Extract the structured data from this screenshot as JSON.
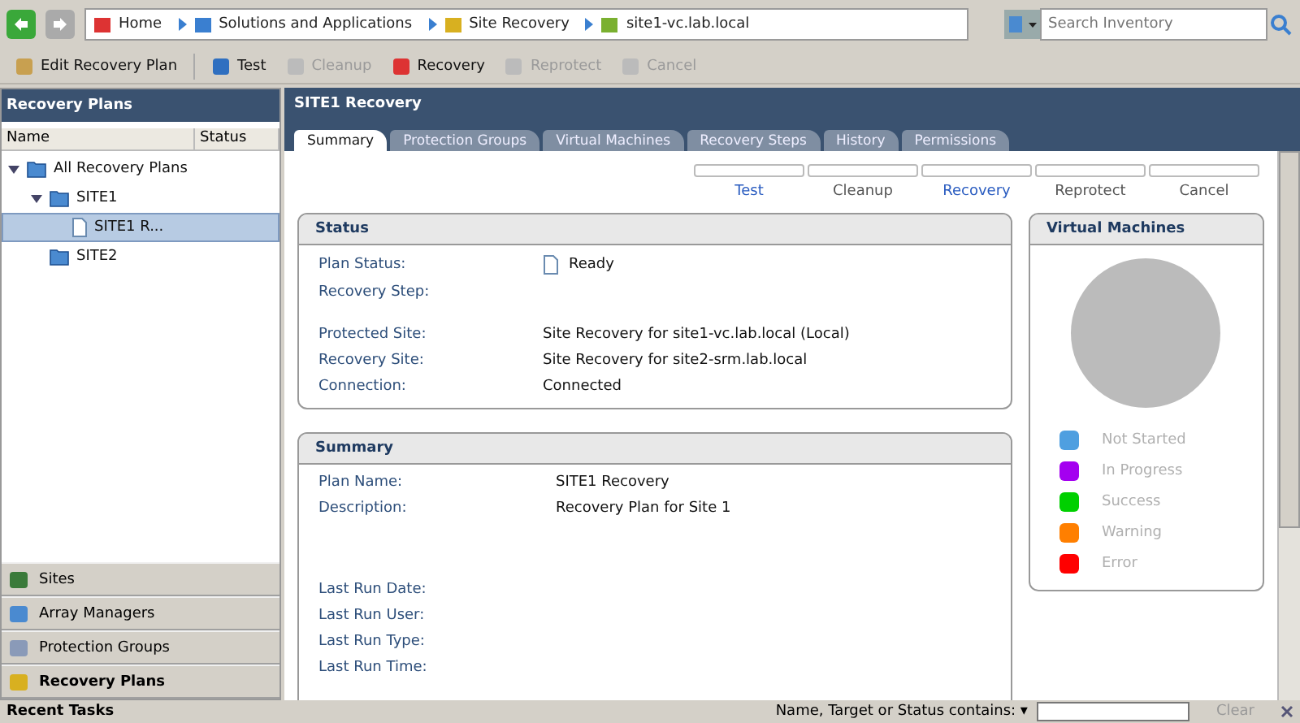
{
  "breadcrumb": [
    "Home",
    "Solutions and Applications",
    "Site Recovery",
    "site1-vc.lab.local"
  ],
  "search": {
    "placeholder": "Search Inventory"
  },
  "toolbar": [
    {
      "label": "Edit Recovery Plan",
      "disabled": false
    },
    {
      "label": "Test",
      "disabled": false
    },
    {
      "label": "Cleanup",
      "disabled": true
    },
    {
      "label": "Recovery",
      "disabled": false
    },
    {
      "label": "Reprotect",
      "disabled": true
    },
    {
      "label": "Cancel",
      "disabled": true
    }
  ],
  "sidebar": {
    "title": "Recovery Plans",
    "columns": [
      "Name",
      "Status"
    ],
    "tree": [
      {
        "label": "All Recovery Plans",
        "kind": "folder",
        "expanded": true,
        "selected": false,
        "children": [
          {
            "label": "SITE1",
            "kind": "folder",
            "expanded": true,
            "selected": false,
            "children": [
              {
                "label": "SITE1  R...",
                "kind": "plan",
                "selected": true
              }
            ]
          },
          {
            "label": "SITE2",
            "kind": "folder",
            "selected": false
          }
        ]
      }
    ],
    "nav": [
      {
        "label": "Sites",
        "selected": false
      },
      {
        "label": "Array Managers",
        "selected": false
      },
      {
        "label": "Protection Groups",
        "selected": false
      },
      {
        "label": "Recovery Plans",
        "selected": true
      }
    ]
  },
  "main": {
    "title": "SITE1 Recovery",
    "tabs": [
      {
        "label": "Summary",
        "selected": true
      },
      {
        "label": "Protection Groups",
        "selected": false
      },
      {
        "label": "Virtual Machines",
        "selected": false
      },
      {
        "label": "Recovery Steps",
        "selected": false
      },
      {
        "label": "History",
        "selected": false
      },
      {
        "label": "Permissions",
        "selected": false
      }
    ],
    "actions": [
      {
        "label": "Test",
        "disabled": false
      },
      {
        "label": "Cleanup",
        "disabled": true
      },
      {
        "label": "Recovery",
        "disabled": false
      },
      {
        "label": "Reprotect",
        "disabled": true
      },
      {
        "label": "Cancel",
        "disabled": true
      }
    ],
    "status": {
      "title": "Status",
      "groups": [
        [
          {
            "label": "Plan Status:",
            "value": "Ready",
            "kind": "icon"
          },
          {
            "label": "Recovery Step:"
          }
        ],
        [
          {
            "label": "Protected Site:",
            "value": "Site Recovery for site1-vc.lab.local (Local)"
          },
          {
            "label": "Recovery Site:",
            "value": "Site Recovery for site2-srm.lab.local"
          },
          {
            "label": "Connection:",
            "value": "Connected"
          }
        ]
      ]
    },
    "summary": {
      "title": "Summary",
      "groups": [
        [
          {
            "label": "Plan Name:",
            "value": "SITE1 Recovery"
          },
          {
            "label": "Description:",
            "value": "Recovery Plan for Site 1"
          }
        ],
        [
          {
            "label": "Last Run Date:"
          },
          {
            "label": "Last Run User:"
          },
          {
            "label": "Last Run Type:"
          },
          {
            "label": "Last Run Time:"
          }
        ]
      ]
    },
    "vms": {
      "title": "Virtual Machines",
      "legend": [
        {
          "label": "Not Started",
          "color": "#4f9fe0"
        },
        {
          "label": "In Progress",
          "color": "#a400f0"
        },
        {
          "label": "Success",
          "color": "#00d000"
        },
        {
          "label": "Warning",
          "color": "#ff7f00"
        },
        {
          "label": "Error",
          "color": "#ff0000"
        }
      ]
    }
  },
  "recent_tasks": {
    "title": "Recent Tasks",
    "filter_label": "Name, Target or Status contains:",
    "filter_caret": "▾",
    "clear": "Clear"
  }
}
